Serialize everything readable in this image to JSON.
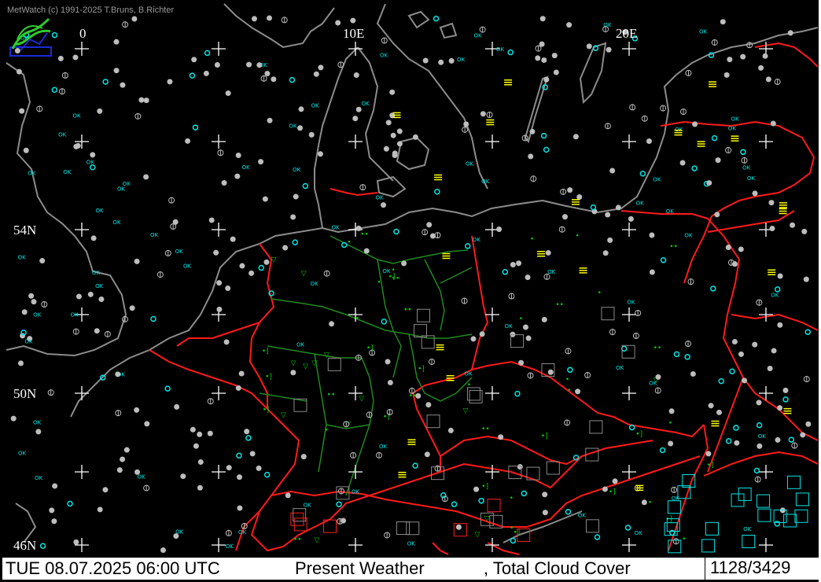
{
  "app": {
    "copyright": "MetWatch  (c) 1991-2025 T.Bruns, B.Richter"
  },
  "map": {
    "longitude_labels": [
      "0",
      "10E",
      "20E"
    ],
    "latitude_labels": [
      "54N",
      "50N",
      "46N"
    ],
    "colors": {
      "background": "#000000",
      "coastline": "#8c8c8c",
      "national_border": "#ff1a1a",
      "state_border": "#1f8a1f",
      "cloud_symbol": "#bdbdbd",
      "clear_sky_symbol": "#00e5e5",
      "weather_green": "#00d000",
      "fog_yellow": "#ffff00",
      "thunder_red": "#ff2020",
      "grid_cross": "#ffffff"
    },
    "legend_symbols": [
      "present-weather",
      "total-cloud-cover"
    ],
    "station_label": "OK"
  },
  "footer": {
    "datetime": "TUE 08.07.2025 06:00 UTC",
    "product": "Present Weather",
    "product2": ", Total Cloud Cover",
    "count": "1128/3429"
  }
}
